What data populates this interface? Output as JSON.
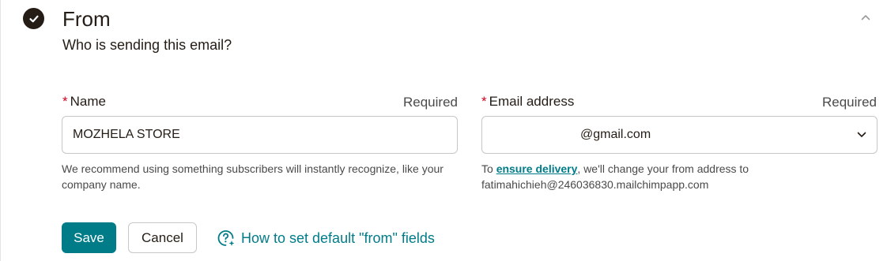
{
  "section": {
    "title": "From",
    "subtitle": "Who is sending this email?",
    "status_icon": "checkmark-circle-icon",
    "collapse_icon": "chevron-up-icon"
  },
  "name_field": {
    "required_mark": "*",
    "label": "Name",
    "required_text": "Required",
    "value": "MOZHELA STORE",
    "help": "We recommend using something subscribers will instantly recognize, like your company name."
  },
  "email_field": {
    "required_mark": "*",
    "label": "Email address",
    "required_text": "Required",
    "value": "@gmail.com",
    "dropdown_icon": "chevron-down-icon",
    "help_prefix": "To ",
    "help_link": "ensure delivery",
    "help_suffix": ", we'll change your from address to fatimahichieh@246036830.mailchimpapp.com"
  },
  "actions": {
    "save_label": "Save",
    "cancel_label": "Cancel",
    "help_link_label": "How to set default \"from\" fields",
    "help_link_icon": "sparkle-question-icon"
  },
  "colors": {
    "accent": "#007c89",
    "required_star": "#d4001f",
    "text": "#241c15"
  }
}
